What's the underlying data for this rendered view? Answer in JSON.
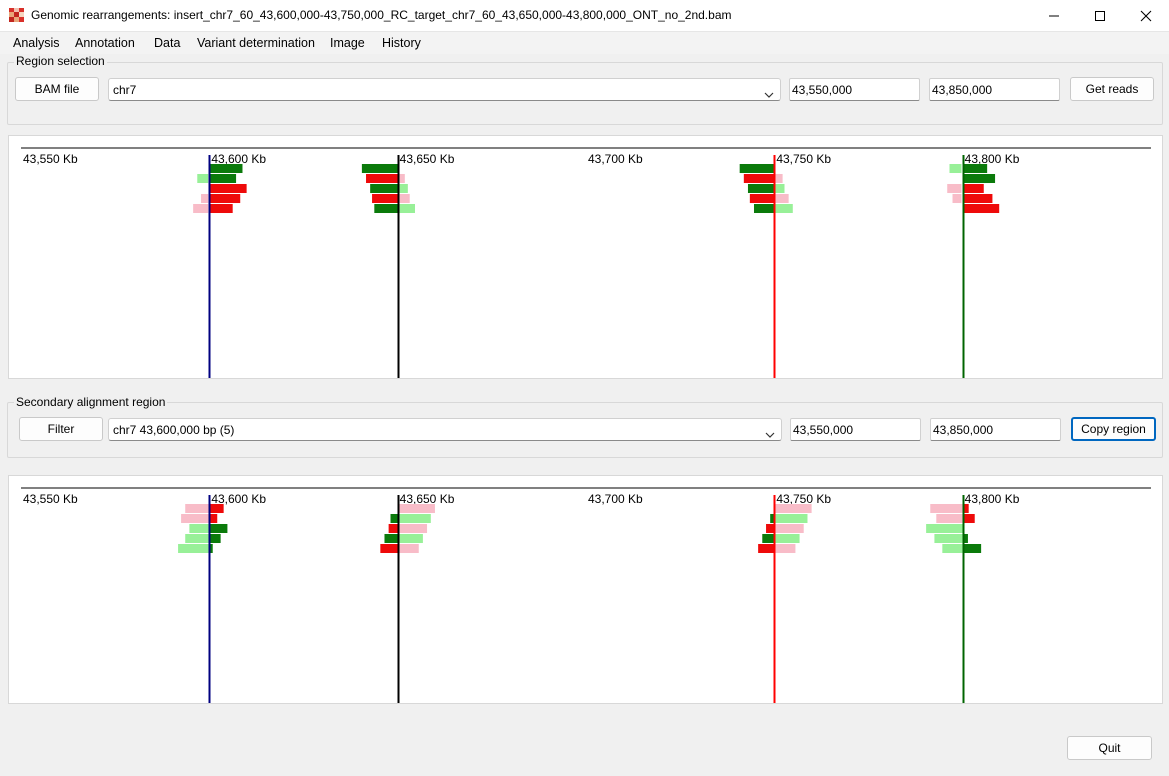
{
  "window": {
    "title": "Genomic rearrangements: insert_chr7_60_43,600,000-43,750,000_RC_target_chr7_60_43,650,000-43,800,000_ONT_no_2nd.bam",
    "app_icon": "dna-puzzle-icon",
    "controls": [
      "minimize-icon",
      "maximize-icon",
      "close-icon"
    ]
  },
  "menu": [
    "Analysis",
    "Annotation",
    "Data",
    "Variant determination",
    "Image",
    "History"
  ],
  "region_selection": {
    "label": "Region selection",
    "bam_button": "BAM file",
    "chromosome": "chr7",
    "start": "43,550,000",
    "end": "43,850,000",
    "get_reads_button": "Get reads"
  },
  "secondary_region": {
    "label": "Secondary alignment region",
    "filter_button": "Filter",
    "selection": "chr7 43,600,000 bp (5)",
    "start": "43,550,000",
    "end": "43,850,000",
    "copy_button": "Copy region"
  },
  "quit_button": "Quit",
  "colors": {
    "dark_green": "#0b7a0b",
    "light_green": "#98f098",
    "red": "#ee0a0a",
    "pink": "#f8bcc8",
    "marker_blue": "#000080",
    "marker_black": "#000000",
    "marker_red": "#ff0000",
    "marker_green": "#006400"
  },
  "chart_data": [
    {
      "type": "other",
      "name": "primary",
      "x_range_kb": [
        43550,
        43850
      ],
      "ticks": [
        {
          "value": 43550,
          "label": "43,550 Kb"
        },
        {
          "value": 43600,
          "label": "43,600 Kb"
        },
        {
          "value": 43650,
          "label": "43,650 Kb"
        },
        {
          "value": 43700,
          "label": "43,700 Kb"
        },
        {
          "value": 43750,
          "label": "43,750 Kb"
        },
        {
          "value": 43800,
          "label": "43,800 Kb"
        }
      ],
      "markers": [
        {
          "pos": 43600,
          "color": "#000080"
        },
        {
          "pos": 43650,
          "color": "#000000"
        },
        {
          "pos": 43750,
          "color": "#ff0000"
        },
        {
          "pos": 43800,
          "color": "#006400"
        }
      ],
      "reads": [
        {
          "row": 0,
          "start": 43600.0,
          "end": 43608.8,
          "color": "#0b7a0b"
        },
        {
          "row": 1,
          "start": 43596.8,
          "end": 43599.7,
          "color": "#98f098"
        },
        {
          "row": 1,
          "start": 43600.0,
          "end": 43607.1,
          "color": "#0b7a0b"
        },
        {
          "row": 2,
          "start": 43600.0,
          "end": 43609.9,
          "color": "#ee0a0a"
        },
        {
          "row": 3,
          "start": 43597.8,
          "end": 43599.7,
          "color": "#f8bcc8"
        },
        {
          "row": 3,
          "start": 43600.0,
          "end": 43608.2,
          "color": "#ee0a0a"
        },
        {
          "row": 4,
          "start": 43595.7,
          "end": 43599.7,
          "color": "#f8bcc8"
        },
        {
          "row": 4,
          "start": 43600.0,
          "end": 43606.2,
          "color": "#ee0a0a"
        },
        {
          "row": 0,
          "start": 43640.5,
          "end": 43650.0,
          "color": "#0b7a0b"
        },
        {
          "row": 1,
          "start": 43641.6,
          "end": 43650.0,
          "color": "#ee0a0a"
        },
        {
          "row": 1,
          "start": 43650.0,
          "end": 43651.9,
          "color": "#f8bcc8"
        },
        {
          "row": 2,
          "start": 43642.7,
          "end": 43650.0,
          "color": "#0b7a0b"
        },
        {
          "row": 2,
          "start": 43650.0,
          "end": 43652.7,
          "color": "#98f098"
        },
        {
          "row": 3,
          "start": 43643.2,
          "end": 43650.0,
          "color": "#ee0a0a"
        },
        {
          "row": 3,
          "start": 43650.0,
          "end": 43653.2,
          "color": "#f8bcc8"
        },
        {
          "row": 4,
          "start": 43643.8,
          "end": 43650.0,
          "color": "#0b7a0b"
        },
        {
          "row": 4,
          "start": 43650.0,
          "end": 43654.6,
          "color": "#98f098"
        },
        {
          "row": 0,
          "start": 43740.8,
          "end": 43750.0,
          "color": "#0b7a0b"
        },
        {
          "row": 1,
          "start": 43741.9,
          "end": 43750.0,
          "color": "#ee0a0a"
        },
        {
          "row": 1,
          "start": 43750.0,
          "end": 43752.2,
          "color": "#f8bcc8"
        },
        {
          "row": 2,
          "start": 43743.0,
          "end": 43750.0,
          "color": "#0b7a0b"
        },
        {
          "row": 2,
          "start": 43750.0,
          "end": 43752.7,
          "color": "#98f098"
        },
        {
          "row": 3,
          "start": 43743.5,
          "end": 43750.0,
          "color": "#ee0a0a"
        },
        {
          "row": 3,
          "start": 43750.0,
          "end": 43753.8,
          "color": "#f8bcc8"
        },
        {
          "row": 4,
          "start": 43744.6,
          "end": 43750.0,
          "color": "#0b7a0b"
        },
        {
          "row": 4,
          "start": 43750.0,
          "end": 43754.9,
          "color": "#98f098"
        },
        {
          "row": 0,
          "start": 43796.5,
          "end": 43799.7,
          "color": "#98f098"
        },
        {
          "row": 0,
          "start": 43800.0,
          "end": 43806.5,
          "color": "#0b7a0b"
        },
        {
          "row": 1,
          "start": 43800.0,
          "end": 43808.6,
          "color": "#0b7a0b"
        },
        {
          "row": 2,
          "start": 43795.9,
          "end": 43799.7,
          "color": "#f8bcc8"
        },
        {
          "row": 2,
          "start": 43800.0,
          "end": 43805.6,
          "color": "#ee0a0a"
        },
        {
          "row": 3,
          "start": 43797.3,
          "end": 43799.7,
          "color": "#f8bcc8"
        },
        {
          "row": 3,
          "start": 43800.0,
          "end": 43807.9,
          "color": "#ee0a0a"
        },
        {
          "row": 4,
          "start": 43800.0,
          "end": 43809.7,
          "color": "#ee0a0a"
        }
      ]
    },
    {
      "type": "other",
      "name": "secondary",
      "x_range_kb": [
        43550,
        43850
      ],
      "ticks": [
        {
          "value": 43550,
          "label": "43,550 Kb"
        },
        {
          "value": 43600,
          "label": "43,600 Kb"
        },
        {
          "value": 43650,
          "label": "43,650 Kb"
        },
        {
          "value": 43700,
          "label": "43,700 Kb"
        },
        {
          "value": 43750,
          "label": "43,750 Kb"
        },
        {
          "value": 43800,
          "label": "43,800 Kb"
        }
      ],
      "markers": [
        {
          "pos": 43600,
          "color": "#000080"
        },
        {
          "pos": 43650,
          "color": "#000000"
        },
        {
          "pos": 43750,
          "color": "#ff0000"
        },
        {
          "pos": 43800,
          "color": "#006400"
        }
      ],
      "reads": [
        {
          "row": 0,
          "start": 43593.6,
          "end": 43600.0,
          "color": "#f8bcc8"
        },
        {
          "row": 0,
          "start": 43600.0,
          "end": 43603.8,
          "color": "#ee0a0a"
        },
        {
          "row": 1,
          "start": 43592.5,
          "end": 43600.0,
          "color": "#f8bcc8"
        },
        {
          "row": 1,
          "start": 43600.0,
          "end": 43602.1,
          "color": "#ee0a0a"
        },
        {
          "row": 2,
          "start": 43594.7,
          "end": 43600.0,
          "color": "#98f098"
        },
        {
          "row": 2,
          "start": 43600.0,
          "end": 43604.8,
          "color": "#0b7a0b"
        },
        {
          "row": 3,
          "start": 43593.6,
          "end": 43600.0,
          "color": "#98f098"
        },
        {
          "row": 3,
          "start": 43600.0,
          "end": 43603.0,
          "color": "#0b7a0b"
        },
        {
          "row": 4,
          "start": 43591.7,
          "end": 43600.0,
          "color": "#98f098"
        },
        {
          "row": 4,
          "start": 43600.0,
          "end": 43600.9,
          "color": "#0b7a0b"
        },
        {
          "row": 0,
          "start": 43650.0,
          "end": 43659.9,
          "color": "#f8bcc8"
        },
        {
          "row": 1,
          "start": 43648.1,
          "end": 43650.0,
          "color": "#0b7a0b"
        },
        {
          "row": 1,
          "start": 43650.0,
          "end": 43658.8,
          "color": "#98f098"
        },
        {
          "row": 2,
          "start": 43647.6,
          "end": 43650.0,
          "color": "#ee0a0a"
        },
        {
          "row": 2,
          "start": 43650.0,
          "end": 43657.8,
          "color": "#f8bcc8"
        },
        {
          "row": 3,
          "start": 43646.5,
          "end": 43650.0,
          "color": "#0b7a0b"
        },
        {
          "row": 3,
          "start": 43650.0,
          "end": 43656.7,
          "color": "#98f098"
        },
        {
          "row": 4,
          "start": 43645.4,
          "end": 43650.0,
          "color": "#ee0a0a"
        },
        {
          "row": 4,
          "start": 43650.0,
          "end": 43655.6,
          "color": "#f8bcc8"
        },
        {
          "row": 0,
          "start": 43750.0,
          "end": 43759.9,
          "color": "#f8bcc8"
        },
        {
          "row": 1,
          "start": 43748.9,
          "end": 43750.0,
          "color": "#0b7a0b"
        },
        {
          "row": 1,
          "start": 43750.0,
          "end": 43758.8,
          "color": "#98f098"
        },
        {
          "row": 2,
          "start": 43747.8,
          "end": 43750.0,
          "color": "#ee0a0a"
        },
        {
          "row": 2,
          "start": 43750.0,
          "end": 43757.8,
          "color": "#f8bcc8"
        },
        {
          "row": 3,
          "start": 43746.8,
          "end": 43750.0,
          "color": "#0b7a0b"
        },
        {
          "row": 3,
          "start": 43750.0,
          "end": 43756.7,
          "color": "#98f098"
        },
        {
          "row": 4,
          "start": 43745.7,
          "end": 43750.0,
          "color": "#ee0a0a"
        },
        {
          "row": 4,
          "start": 43750.0,
          "end": 43755.6,
          "color": "#f8bcc8"
        },
        {
          "row": 0,
          "start": 43791.4,
          "end": 43800.0,
          "color": "#f8bcc8"
        },
        {
          "row": 0,
          "start": 43800.0,
          "end": 43801.6,
          "color": "#ee0a0a"
        },
        {
          "row": 1,
          "start": 43793.0,
          "end": 43800.0,
          "color": "#f8bcc8"
        },
        {
          "row": 1,
          "start": 43800.0,
          "end": 43803.2,
          "color": "#ee0a0a"
        },
        {
          "row": 2,
          "start": 43790.3,
          "end": 43800.0,
          "color": "#98f098"
        },
        {
          "row": 2,
          "start": 43800.0,
          "end": 43800.4,
          "color": "#0b7a0b"
        },
        {
          "row": 3,
          "start": 43792.5,
          "end": 43800.0,
          "color": "#98f098"
        },
        {
          "row": 3,
          "start": 43800.0,
          "end": 43801.4,
          "color": "#0b7a0b"
        },
        {
          "row": 4,
          "start": 43794.6,
          "end": 43800.0,
          "color": "#98f098"
        },
        {
          "row": 4,
          "start": 43800.0,
          "end": 43804.9,
          "color": "#0b7a0b"
        }
      ]
    }
  ]
}
